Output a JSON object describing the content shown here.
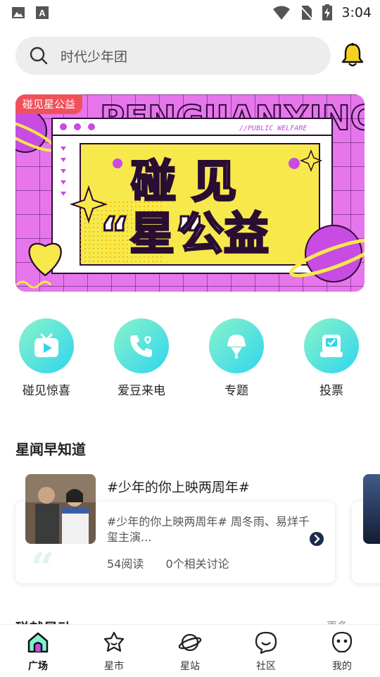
{
  "status_bar": {
    "time": "3:04"
  },
  "search": {
    "placeholder": "时代少年团"
  },
  "banner": {
    "tag": "碰见星公益",
    "line1": "碰 见",
    "line2_a": "“星”",
    "line2_b": "公益",
    "small_text": "//PUBLIC WELFARE",
    "deco_text": "PENGJIANXING"
  },
  "quick_actions": [
    {
      "label": "碰见惊喜",
      "icon": "tv-play-icon"
    },
    {
      "label": "爱豆来电",
      "icon": "phone-heart-icon"
    },
    {
      "label": "专题",
      "icon": "ice-cream-icon"
    },
    {
      "label": "投票",
      "icon": "vote-box-icon"
    }
  ],
  "news_section": {
    "title": "星闻早知道",
    "card": {
      "title": "#少年的你上映两周年#",
      "description": "#少年的你上映两周年# 周冬雨、易烊千玺主演...",
      "reads": "54阅读",
      "discussions": "0个相关讨论"
    }
  },
  "next_section": {
    "title": "碰就是动",
    "more": "更多 ›"
  },
  "tabs": [
    {
      "label": "广场",
      "active": true
    },
    {
      "label": "星市",
      "active": false
    },
    {
      "label": "星站",
      "active": false
    },
    {
      "label": "社区",
      "active": false
    },
    {
      "label": "我的",
      "active": false
    }
  ],
  "colors": {
    "accent": "#1db9c8",
    "banner_bg": "#e776ec",
    "banner_yellow": "#f7e94b",
    "tag_red": "#f0515b"
  }
}
